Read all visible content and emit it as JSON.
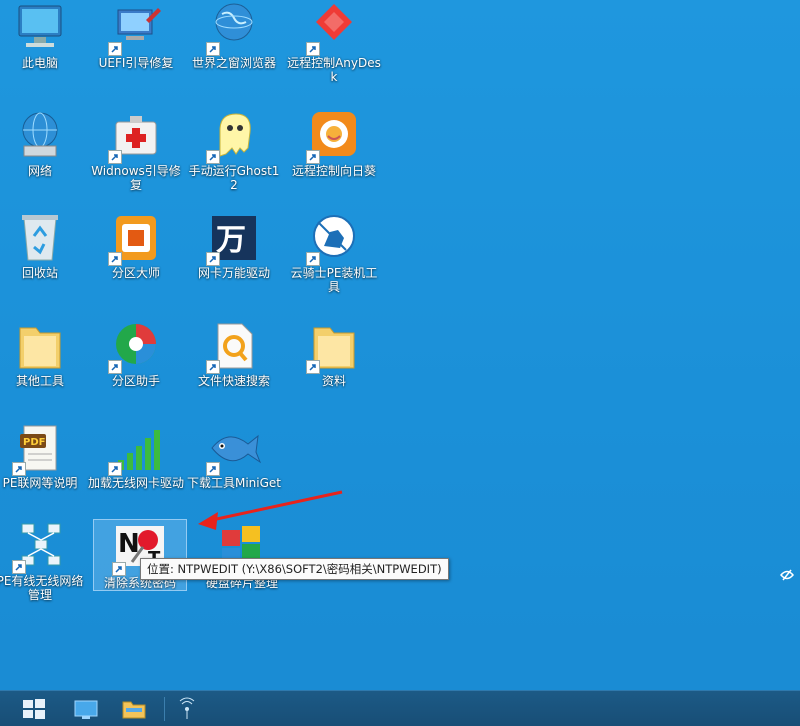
{
  "desktop": {
    "icons": [
      {
        "label": "此电脑",
        "icon": "computer-icon",
        "shortcut": false
      },
      {
        "label": "UEFI引导修复",
        "icon": "uefi-repair-icon",
        "shortcut": true
      },
      {
        "label": "世界之窗浏览器",
        "icon": "globe-browser-icon",
        "shortcut": true
      },
      {
        "label": "远程控制AnyDesk",
        "icon": "anydesk-icon",
        "shortcut": true
      },
      {
        "label": "网络",
        "icon": "network-icon",
        "shortcut": false
      },
      {
        "label": "Widnows引导修复",
        "icon": "first-aid-kit-icon",
        "shortcut": true
      },
      {
        "label": "手动运行Ghost12",
        "icon": "ghost-icon",
        "shortcut": true
      },
      {
        "label": "远程控制向日葵",
        "icon": "sunflower-icon",
        "shortcut": true
      },
      {
        "label": "回收站",
        "icon": "recycle-bin-icon",
        "shortcut": false
      },
      {
        "label": "分区大师",
        "icon": "partition-master-icon",
        "shortcut": true
      },
      {
        "label": "网卡万能驱动",
        "icon": "wan-driver-icon",
        "shortcut": true
      },
      {
        "label": "云骑士PE装机工具",
        "icon": "knight-icon",
        "shortcut": true
      },
      {
        "label": "其他工具",
        "icon": "folder-icon",
        "shortcut": false
      },
      {
        "label": "分区助手",
        "icon": "partition-assistant-icon",
        "shortcut": true
      },
      {
        "label": "文件快速搜索",
        "icon": "file-search-icon",
        "shortcut": true
      },
      {
        "label": "资料",
        "icon": "folder-icon",
        "shortcut": true
      },
      {
        "label": "PE联网等说明",
        "icon": "pdf-icon",
        "shortcut": true
      },
      {
        "label": "加载无线网卡驱动",
        "icon": "signal-bars-icon",
        "shortcut": true
      },
      {
        "label": "下载工具MiniGet",
        "icon": "fish-icon",
        "shortcut": true
      },
      {
        "label": "PE有线无线网络管理",
        "icon": "network-topology-icon",
        "shortcut": true
      },
      {
        "label": "清除系统密码",
        "icon": "ntpwedit-icon",
        "shortcut": true
      },
      {
        "label": "硬盘碎片整理",
        "icon": "defrag-icon",
        "shortcut": false
      }
    ]
  },
  "tooltip": {
    "text": "位置: NTPWEDIT (Y:\\X86\\SOFT2\\密码相关\\NTPWEDIT)"
  },
  "taskbar": {
    "start": "windows-start-icon",
    "buttons": [
      "desktop-icon",
      "file-explorer-icon"
    ],
    "tray": [
      "wireless-icon"
    ]
  },
  "colors": {
    "desktop": "#1f97de",
    "taskbar": "#1c5a86",
    "arrow": "#e8231c"
  }
}
